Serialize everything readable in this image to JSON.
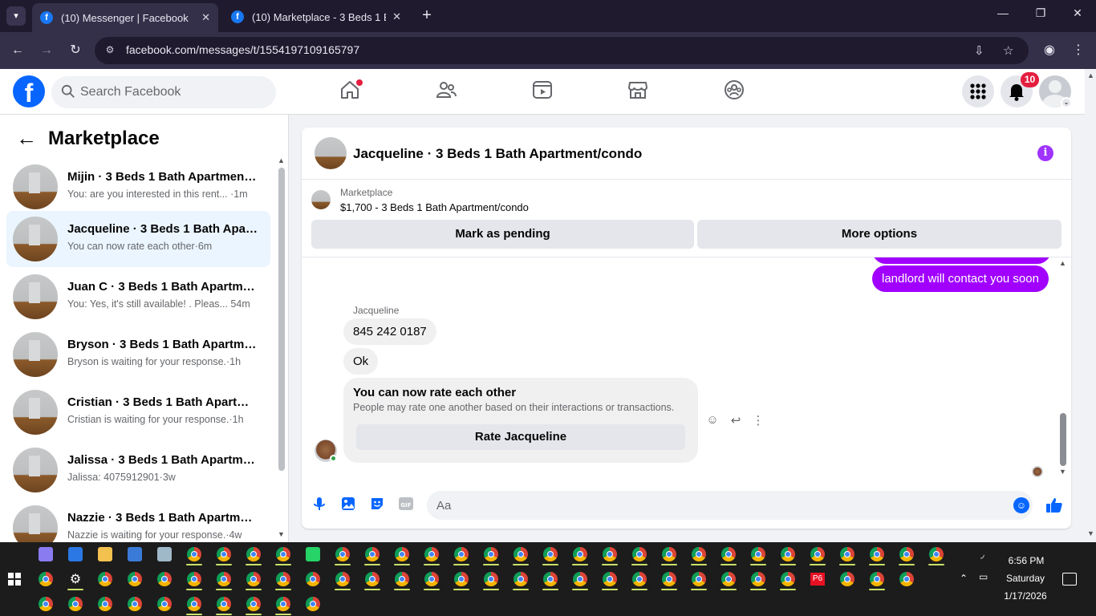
{
  "browser": {
    "tabs": [
      {
        "title": "(10) Messenger | Facebook",
        "active": true
      },
      {
        "title": "(10) Marketplace - 3 Beds 1 Bath",
        "active": false
      }
    ],
    "url": "facebook.com/messages/t/1554197109165797"
  },
  "header": {
    "search_placeholder": "Search Facebook",
    "notification_count": "10",
    "logo": "f"
  },
  "sidebar": {
    "title": "Marketplace",
    "conversations": [
      {
        "name": "Mijin · 3 Beds 1 Bath Apartment/...",
        "preview": "You: are you interested in this rent... ·1m",
        "selected": false
      },
      {
        "name": "Jacqueline · 3 Beds 1 Bath Apart...",
        "preview": "You can now rate each other·6m",
        "selected": true
      },
      {
        "name": "Juan C · 3 Beds 1 Bath Apartmen...",
        "preview": "You: Yes, it's still available! . Pleas...   54m",
        "selected": false
      },
      {
        "name": "Bryson · 3 Beds 1 Bath Apartme...",
        "preview": "Bryson is waiting for your response.·1h",
        "selected": false
      },
      {
        "name": "Cristian · 3 Beds 1 Bath Apartme...",
        "preview": "Cristian is waiting for your response.·1h",
        "selected": false
      },
      {
        "name": "Jalissa · 3 Beds 1 Bath Apartmen...",
        "preview": "Jalissa: 4075912901·3w",
        "selected": false
      },
      {
        "name": "Nazzie · 3 Beds 1 Bath Apartmen...",
        "preview": "Nazzie is waiting for your response.·4w",
        "selected": false
      }
    ]
  },
  "chat": {
    "title": "Jacqueline · 3 Beds 1 Bath Apartment/condo",
    "listing": {
      "category": "Marketplace",
      "description": "$1,700 - 3 Beds 1 Bath Apartment/condo",
      "pending_button": "Mark as pending",
      "options_button": "More options"
    },
    "outgoing_last": "landlord will contact you soon",
    "sender_name": "Jacqueline",
    "incoming": [
      "845 242 0187",
      "Ok"
    ],
    "rate_card": {
      "heading": "You can now rate each other",
      "body": "People may rate one another based on their interactions or transactions.",
      "button": "Rate Jacqueline"
    },
    "composer_placeholder": "Aa",
    "colors": {
      "outgoing": "#a100ff",
      "accent": "#0866ff"
    }
  },
  "taskbar": {
    "time": "6:56 PM",
    "day": "Saturday",
    "date": "1/17/2026",
    "pinned_label": "P6"
  }
}
